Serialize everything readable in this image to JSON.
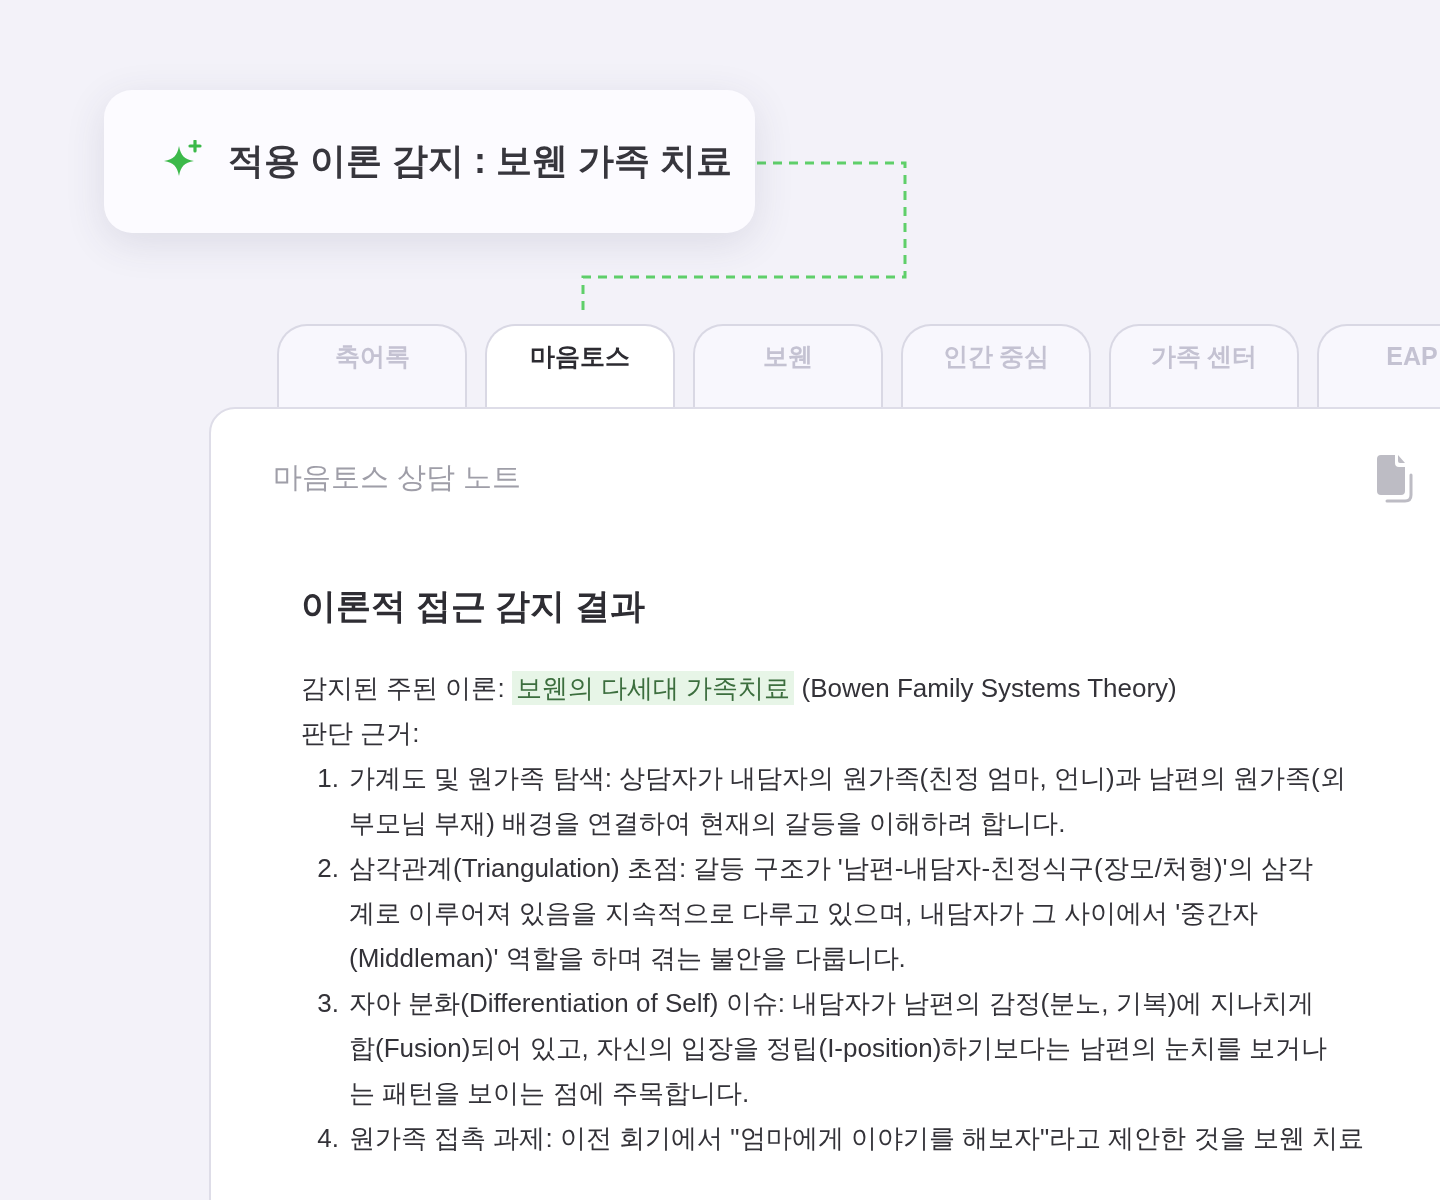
{
  "detection_badge": {
    "title": "적용 이론 감지 : 보웬 가족 치료"
  },
  "tabs": [
    {
      "label": "축어록",
      "selected": false
    },
    {
      "label": "마음토스",
      "selected": true
    },
    {
      "label": "보웬",
      "selected": false
    },
    {
      "label": "인간 중심",
      "selected": false
    },
    {
      "label": "가족 센터",
      "selected": false
    },
    {
      "label": "EAP",
      "selected": false
    }
  ],
  "note": {
    "title": "마음토스 상담 노트",
    "heading": "이론적 접근 감지 결과",
    "theory": {
      "label": "감지된 주된 이론:",
      "highlight": "보웬의 다세대 가족치료",
      "rest": "(Bowen Family Systems Theory)"
    },
    "basis_label": "판단 근거:",
    "items": [
      {
        "number": "1.",
        "lines": [
          "가계도 및 원가족 탐색: 상담자가 내담자의 원가족(친정 엄마, 언니)과 남편의 원가족(외",
          "부모님 부재) 배경을 연결하여 현재의 갈등을 이해하려 합니다."
        ]
      },
      {
        "number": "2.",
        "lines": [
          "삼각관계(Triangulation) 초점: 갈등 구조가 '남편-내담자-친정식구(장모/처형)'의 삼각",
          "계로 이루어져 있음을 지속적으로 다루고 있으며, 내담자가 그 사이에서 '중간자",
          "(Middleman)' 역할을 하며 겪는 불안을 다룹니다."
        ]
      },
      {
        "number": "3.",
        "lines": [
          "자아 분화(Differentiation of Self) 이슈: 내담자가 남편의 감정(분노, 기복)에 지나치게",
          "합(Fusion)되어 있고, 자신의 입장을 정립(I-position)하기보다는 남편의 눈치를 보거나",
          "는 패턴을 보이는 점에 주목합니다."
        ]
      },
      {
        "number": "4.",
        "lines": [
          "원가족 접촉 과제: 이전 회기에서 \"엄마에게 이야기를 해보자\"라고 제안한 것을 보웬 치료"
        ]
      }
    ]
  }
}
